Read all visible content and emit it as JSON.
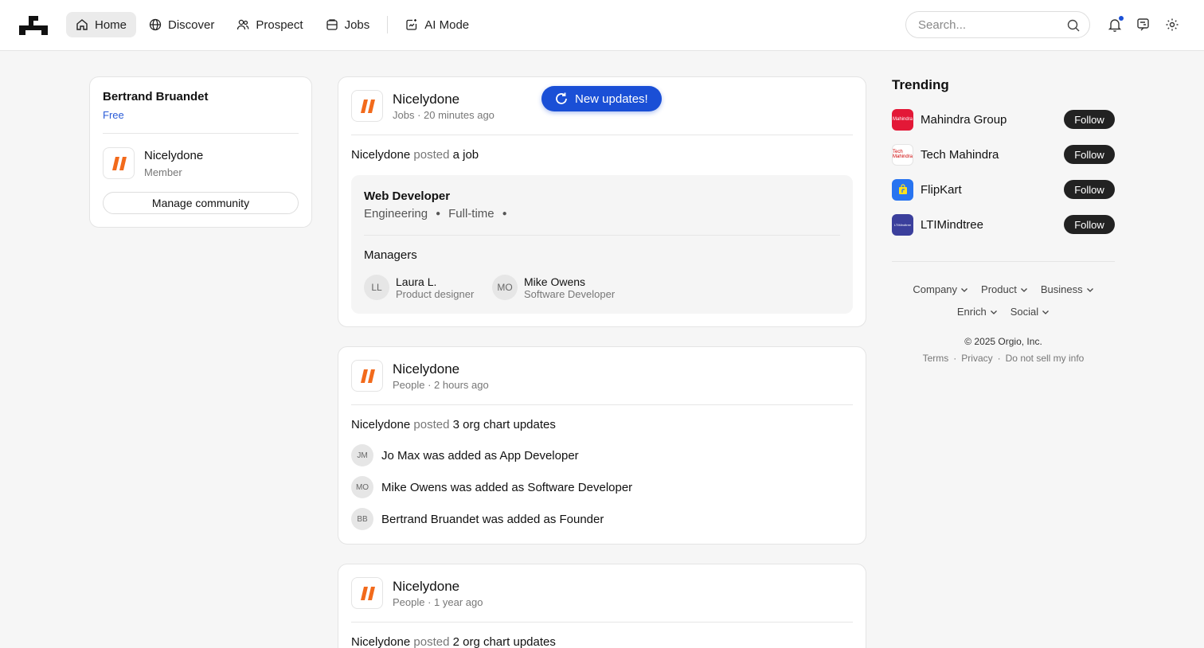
{
  "nav": {
    "items": [
      {
        "label": "Home",
        "icon": "home-icon",
        "active": true
      },
      {
        "label": "Discover",
        "icon": "globe-icon"
      },
      {
        "label": "Prospect",
        "icon": "users-icon"
      },
      {
        "label": "Jobs",
        "icon": "briefcase-icon"
      },
      {
        "label": "AI Mode",
        "icon": "ai-sparkle-icon"
      }
    ],
    "search_placeholder": "Search..."
  },
  "profile": {
    "name": "Bertrand Bruandet",
    "plan": "Free",
    "org_name": "Nicelydone",
    "org_role": "Member",
    "manage_label": "Manage community"
  },
  "new_updates_label": "New updates!",
  "posts": [
    {
      "author": "Nicelydone",
      "meta": "Jobs · 20 minutes ago",
      "line_author": "Nicelydone",
      "line_verb": "posted",
      "line_object": "a job",
      "job": {
        "title": "Web Developer",
        "department": "Engineering",
        "type": "Full-time",
        "managers_heading": "Managers",
        "managers": [
          {
            "initials": "LL",
            "name": "Laura L.",
            "role": "Product designer"
          },
          {
            "initials": "MO",
            "name": "Mike Owens",
            "role": "Software Developer"
          }
        ]
      }
    },
    {
      "author": "Nicelydone",
      "meta": "People · 2 hours ago",
      "line_author": "Nicelydone",
      "line_verb": "posted",
      "line_object": "3 org chart updates",
      "updates": [
        {
          "initials": "JM",
          "name": "Jo Max",
          "text": "was added as App Developer"
        },
        {
          "initials": "MO",
          "name": "Mike Owens",
          "text": "was added as Software Developer"
        },
        {
          "initials": "BB",
          "name": "Bertrand Bruandet",
          "text": "was added as Founder"
        }
      ]
    },
    {
      "author": "Nicelydone",
      "meta": "People · 1 year ago",
      "line_author": "Nicelydone",
      "line_verb": "posted",
      "line_object": "2 org chart updates"
    }
  ],
  "trending": {
    "heading": "Trending",
    "follow_label": "Follow",
    "items": [
      {
        "name": "Mahindra Group",
        "logo_text": "Mahindra",
        "color": "#e31837"
      },
      {
        "name": "Tech Mahindra",
        "logo_text": "Tech Mahindra",
        "color": "#ffffff"
      },
      {
        "name": "FlipKart",
        "logo_text": "",
        "color": "#2874f0"
      },
      {
        "name": "LTIMindtree",
        "logo_text": "LTIMindtree",
        "color": "#3b3f9c"
      }
    ]
  },
  "footer": {
    "menus_row1": [
      "Company",
      "Product",
      "Business"
    ],
    "menus_row2": [
      "Enrich",
      "Social"
    ],
    "copyright": "© 2025 Orgio, Inc.",
    "legal": [
      "Terms",
      "Privacy",
      "Do not sell my info"
    ]
  }
}
